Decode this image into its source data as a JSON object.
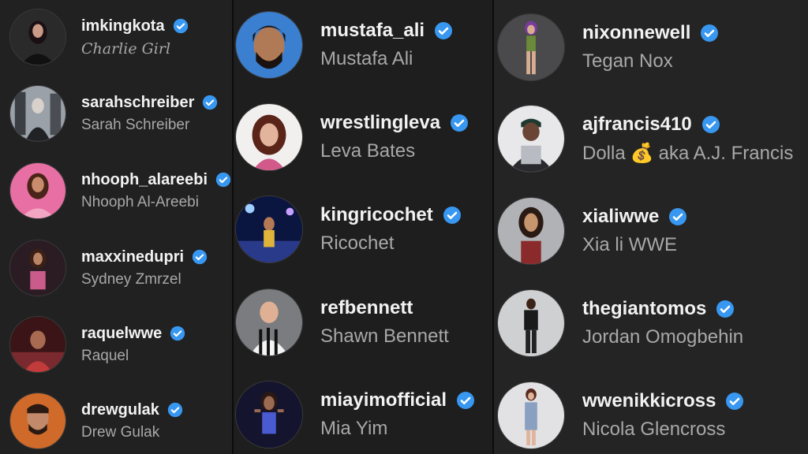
{
  "accounts_left": [
    {
      "username": "imkingkota",
      "display_name": "Charlie Girl",
      "verified": true
    },
    {
      "username": "sarahschreiber",
      "display_name": "Sarah Schreiber",
      "verified": true
    },
    {
      "username": "nhooph_alareebi",
      "display_name": "Nhooph Al-Areebi",
      "verified": true
    },
    {
      "username": "maxxinedupri",
      "display_name": "Sydney Zmrzel",
      "verified": true
    },
    {
      "username": "raquelwwe",
      "display_name": "Raquel",
      "verified": true
    },
    {
      "username": "drewgulak",
      "display_name": "Drew Gulak",
      "verified": true
    }
  ],
  "accounts_middle": [
    {
      "username": "mustafa_ali",
      "display_name": "Mustafa Ali",
      "verified": true
    },
    {
      "username": "wrestlingleva",
      "display_name": "Leva Bates",
      "verified": true
    },
    {
      "username": "kingricochet",
      "display_name": "Ricochet",
      "verified": true
    },
    {
      "username": "refbennett",
      "display_name": "Shawn Bennett",
      "verified": false
    },
    {
      "username": "miayimofficial",
      "display_name": "Mia Yim",
      "verified": true
    }
  ],
  "accounts_right": [
    {
      "username": "nixonnewell",
      "display_name": "Tegan Nox",
      "verified": true
    },
    {
      "username": "ajfrancis410",
      "display_name_before": "Dolla",
      "display_name_emoji": "💰",
      "display_name_after": "aka A.J. Francis",
      "verified": true
    },
    {
      "username": "xialiwwe",
      "display_name": "Xia li WWE",
      "verified": true
    },
    {
      "username": "thegiantomos",
      "display_name": "Jordan Omogbehin",
      "verified": true
    },
    {
      "username": "wwenikkicross",
      "display_name": "Nicola Glencross",
      "verified": true
    }
  ],
  "colors": {
    "verified_badge": "#3897f0",
    "username_text": "#f2f2f2",
    "display_name_text": "#a8a8a8",
    "background": "#212121"
  },
  "icons": {
    "verified": "verified-badge-icon"
  }
}
